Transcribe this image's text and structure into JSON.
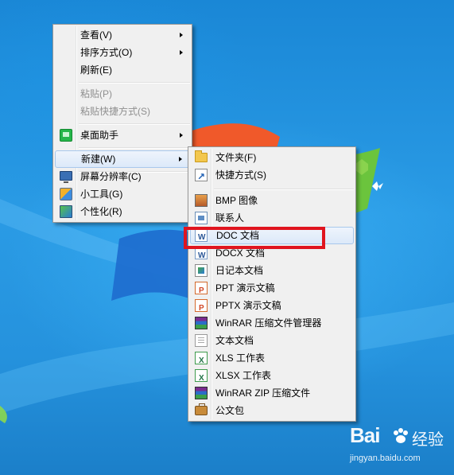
{
  "context_menu": {
    "items": [
      {
        "label": "查看(V)"
      },
      {
        "label": "排序方式(O)"
      },
      {
        "label": "刷新(E)"
      },
      {
        "label": "粘贴(P)"
      },
      {
        "label": "粘贴快捷方式(S)"
      },
      {
        "label": "桌面助手"
      },
      {
        "label": "新建(W)"
      },
      {
        "label": "屏幕分辨率(C)"
      },
      {
        "label": "小工具(G)"
      },
      {
        "label": "个性化(R)"
      }
    ]
  },
  "new_submenu": {
    "items": [
      {
        "label": "文件夹(F)",
        "icon": "folder-icon"
      },
      {
        "label": "快捷方式(S)",
        "icon": "shortcut-icon"
      },
      {
        "label": "BMP 图像",
        "icon": "bitmap-image-icon"
      },
      {
        "label": "联系人",
        "icon": "contact-icon"
      },
      {
        "label": "DOC 文档",
        "icon": "word-document-icon"
      },
      {
        "label": "DOCX 文档",
        "icon": "word-document-icon"
      },
      {
        "label": "日记本文档",
        "icon": "journal-icon"
      },
      {
        "label": "PPT 演示文稿",
        "icon": "powerpoint-icon"
      },
      {
        "label": "PPTX 演示文稿",
        "icon": "powerpoint-icon"
      },
      {
        "label": "WinRAR 压缩文件管理器",
        "icon": "winrar-icon"
      },
      {
        "label": "文本文档",
        "icon": "text-document-icon"
      },
      {
        "label": "XLS 工作表",
        "icon": "excel-icon"
      },
      {
        "label": "XLSX 工作表",
        "icon": "excel-icon"
      },
      {
        "label": "WinRAR ZIP 压缩文件",
        "icon": "winrar-icon"
      },
      {
        "label": "公文包",
        "icon": "briefcase-icon"
      }
    ]
  },
  "watermark": {
    "logo": "Bai",
    "logo_suffix": "经验",
    "url": "jingyan.baidu.com"
  },
  "colors": {
    "highlight": "#e0141e",
    "desktop": "#2592dd"
  }
}
